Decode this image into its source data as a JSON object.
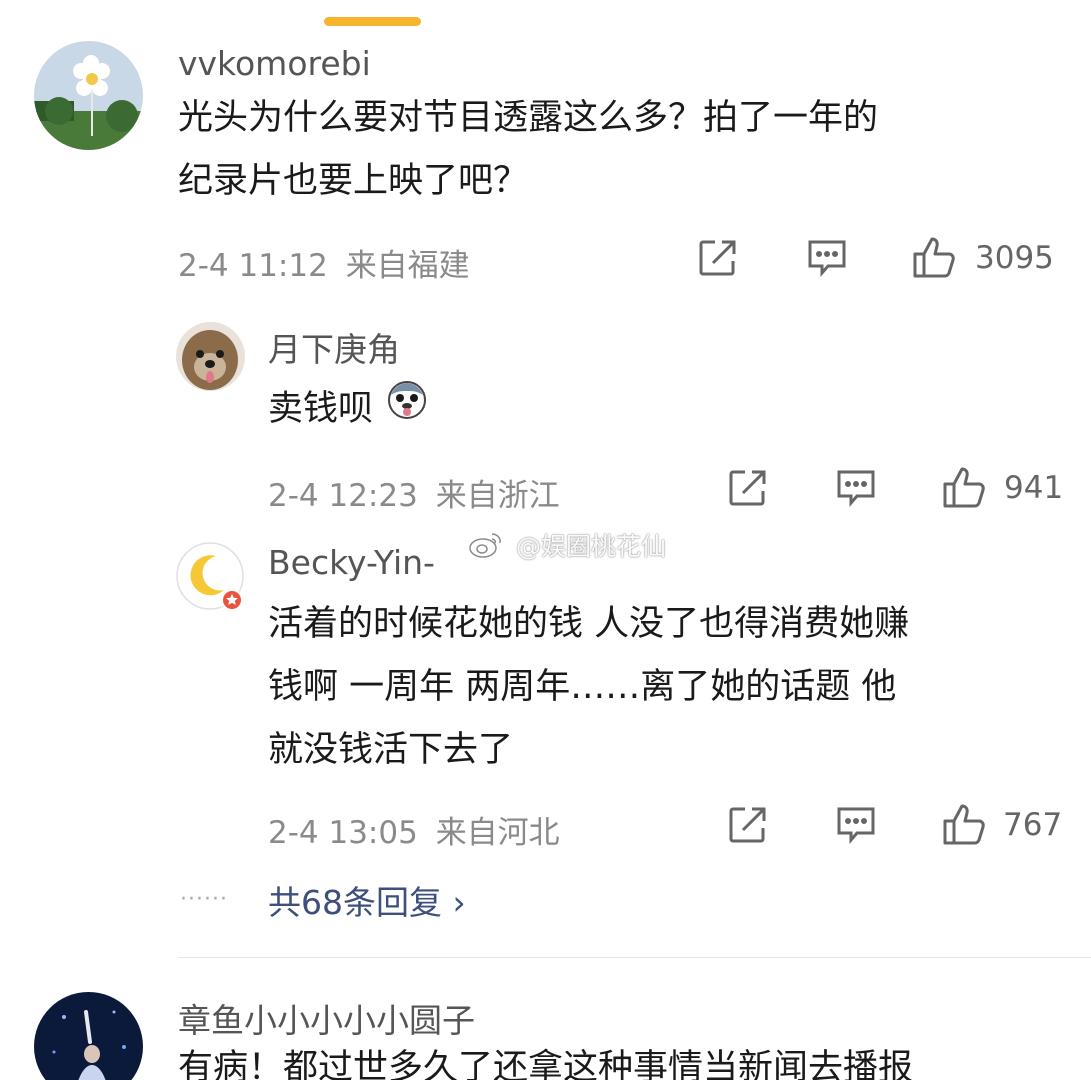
{
  "comments": [
    {
      "username": "vvkomorebi",
      "lines": [
        "光头为什么要对节目透露这么多？拍了一年的",
        "纪录片也要上映了吧？"
      ],
      "time": "2-4 11:12",
      "location": "来自福建",
      "likes": "3095"
    },
    {
      "username": "月下庚角",
      "lines": [
        "卖钱呗"
      ],
      "emoji": "doge-emoji",
      "time": "2-4 12:23",
      "location": "来自浙江",
      "likes": "941"
    },
    {
      "username": "Becky-Yin-",
      "lines": [
        "活着的时候花她的钱 人没了也得消费她赚",
        "钱啊 一周年 两周年……离了她的话题 他",
        "就没钱活下去了"
      ],
      "time": "2-4 13:05",
      "location": "来自河北",
      "likes": "767"
    },
    {
      "username": "章鱼小小小小小圆子",
      "lines": [
        "有病！都过世多久了还拿这种事情当新闻去播报"
      ]
    }
  ],
  "replies_link": "共68条回复 ›",
  "watermark": "@娱圈桃花仙",
  "icons": [
    "share-icon",
    "comment-icon",
    "like-icon",
    "weibo-logo-icon",
    "moon-icon",
    "doge-emoji"
  ],
  "colors": {
    "handle": "#f5b52e",
    "link": "#3d4f7a",
    "meta": "#8a8a8a"
  }
}
